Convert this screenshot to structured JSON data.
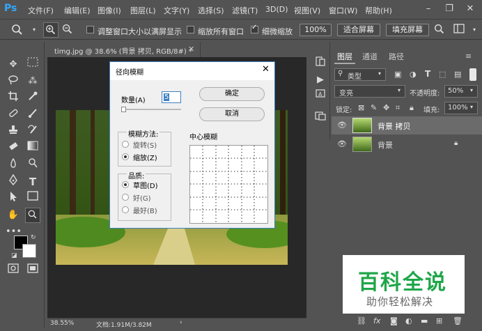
{
  "app": {
    "logo": "Ps"
  },
  "menu": [
    "文件(F)",
    "编辑(E)",
    "图像(I)",
    "图层(L)",
    "文字(Y)",
    "选择(S)",
    "滤镜(T)",
    "3D(D)",
    "视图(V)",
    "窗口(W)",
    "帮助(H)"
  ],
  "options": {
    "resize_windows_label": "调整窗口大小以满屏显示",
    "zoom_all_label": "缩放所有窗口",
    "scrubby_zoom_label": "细微缩放",
    "zoom_100": "100%",
    "fit_screen": "适合屏幕",
    "fill_screen": "填充屏幕"
  },
  "document": {
    "tab_title": "timg.jpg @ 38.6% (背景 拷贝, RGB/8#) *",
    "zoom": "38.55%",
    "doc_info": "文档:1.91M/3.82M"
  },
  "dialog": {
    "title": "径向模糊",
    "amount_label": "数量(A)",
    "amount_value": "5",
    "ok": "确定",
    "cancel": "取消",
    "blur_method_label": "模糊方法:",
    "spin": "旋转(S)",
    "zoom": "缩放(Z)",
    "quality_label": "品质:",
    "draft": "草图(D)",
    "good": "好(G)",
    "best": "最好(B)",
    "center_label": "中心模糊"
  },
  "layers_panel": {
    "tabs": [
      "图层",
      "通道",
      "路径"
    ],
    "filter_kind": "类型",
    "blend_mode": "变亮",
    "opacity_label": "不透明度:",
    "opacity_value": "50%",
    "lock_label": "锁定:",
    "fill_label": "填充:",
    "fill_value": "100%",
    "layers": [
      {
        "name": "背景 拷贝",
        "selected": true
      },
      {
        "name": "背景",
        "selected": false
      }
    ]
  },
  "watermark": {
    "title": "百科全说",
    "subtitle": "助你轻松解决"
  }
}
